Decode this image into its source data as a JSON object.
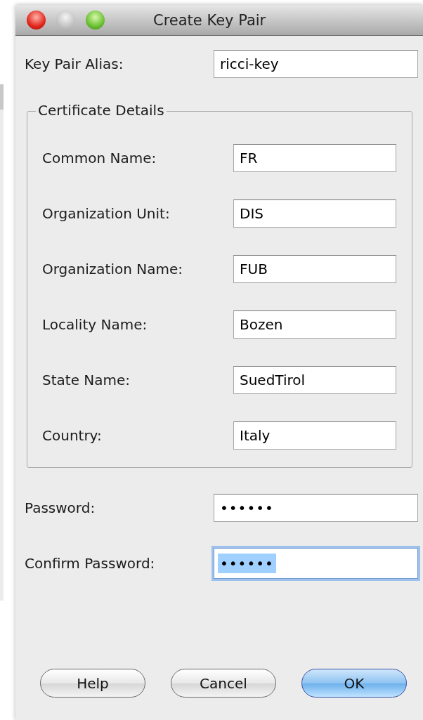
{
  "window": {
    "title": "Create Key Pair"
  },
  "alias": {
    "label": "Key Pair Alias:",
    "value": "ricci-key"
  },
  "certificate": {
    "title": "Certificate Details",
    "fields": [
      {
        "label": "Common Name:",
        "value": "FR"
      },
      {
        "label": "Organization Unit:",
        "value": "DIS"
      },
      {
        "label": "Organization Name:",
        "value": "FUB"
      },
      {
        "label": "Locality Name:",
        "value": "Bozen"
      },
      {
        "label": "State Name:",
        "value": "SuedTirol"
      },
      {
        "label": "Country:",
        "value": "Italy"
      }
    ]
  },
  "passwords": [
    {
      "label": "Password:",
      "value": "••••••",
      "focused": false
    },
    {
      "label": "Confirm Password:",
      "value": "••••••",
      "focused": true
    }
  ],
  "buttons": [
    {
      "label": "Help",
      "default": false
    },
    {
      "label": "Cancel",
      "default": false
    },
    {
      "label": "OK",
      "default": true
    }
  ]
}
